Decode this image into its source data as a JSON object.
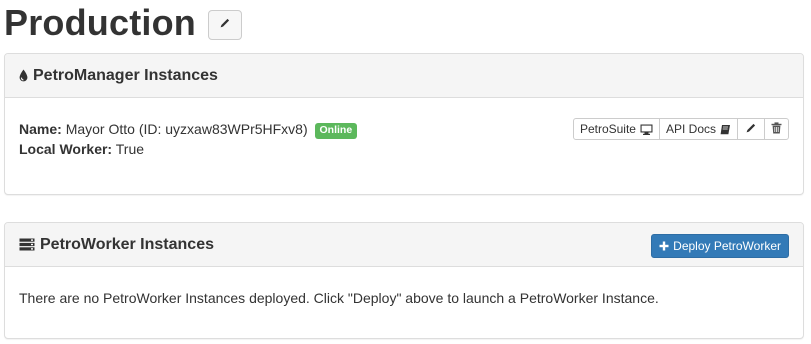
{
  "page": {
    "title": "Production",
    "edit_title_icon": "pencil-icon"
  },
  "manager_panel": {
    "heading": "PetroManager Instances",
    "heading_icon": "tint-drop-icon",
    "instance": {
      "name_label": "Name:",
      "name_value": "Mayor Otto (ID: uyzxaw83WPr5HFxv8)",
      "status_badge": "Online",
      "local_worker_label": "Local Worker:",
      "local_worker_value": "True"
    },
    "actions": {
      "petrosuite_label": "PetroSuite",
      "petrosuite_icon": "monitor-icon",
      "api_docs_label": "API Docs",
      "api_docs_icon": "book-icon",
      "edit_icon": "pencil-icon",
      "delete_icon": "trash-icon"
    }
  },
  "worker_panel": {
    "heading": "PetroWorker Instances",
    "heading_icon": "server-list-icon",
    "deploy_button_label": "Deploy PetroWorker",
    "deploy_button_icon": "plus-icon",
    "empty_message": "There are no PetroWorker Instances deployed. Click \"Deploy\" above to launch a PetroWorker Instance."
  },
  "colors": {
    "badge_success": "#5cb85c",
    "primary_button": "#337ab7",
    "panel_heading_bg": "#f5f5f5",
    "panel_border": "#dddddd",
    "text": "#333333"
  }
}
